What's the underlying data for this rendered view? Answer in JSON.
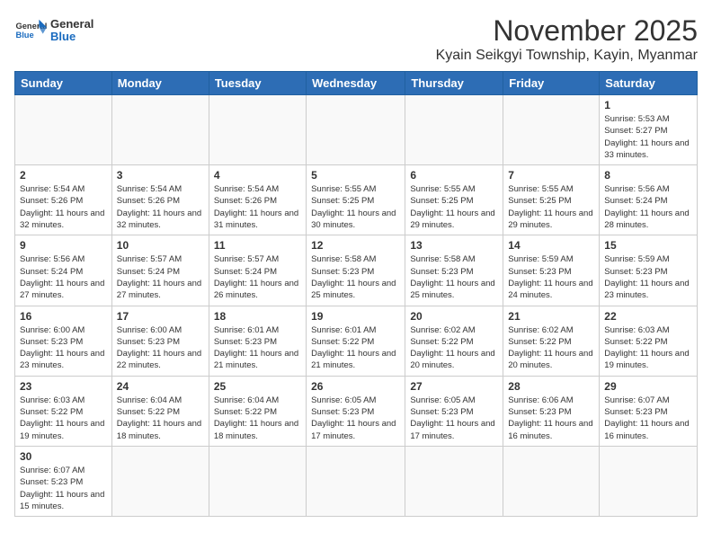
{
  "header": {
    "logo_general": "General",
    "logo_blue": "Blue",
    "month_title": "November 2025",
    "location": "Kyain Seikgyi Township, Kayin, Myanmar"
  },
  "days_of_week": [
    "Sunday",
    "Monday",
    "Tuesday",
    "Wednesday",
    "Thursday",
    "Friday",
    "Saturday"
  ],
  "weeks": [
    [
      {
        "day": null,
        "info": null
      },
      {
        "day": null,
        "info": null
      },
      {
        "day": null,
        "info": null
      },
      {
        "day": null,
        "info": null
      },
      {
        "day": null,
        "info": null
      },
      {
        "day": null,
        "info": null
      },
      {
        "day": "1",
        "info": "Sunrise: 5:53 AM\nSunset: 5:27 PM\nDaylight: 11 hours and 33 minutes."
      }
    ],
    [
      {
        "day": "2",
        "info": "Sunrise: 5:54 AM\nSunset: 5:26 PM\nDaylight: 11 hours and 32 minutes."
      },
      {
        "day": "3",
        "info": "Sunrise: 5:54 AM\nSunset: 5:26 PM\nDaylight: 11 hours and 32 minutes."
      },
      {
        "day": "4",
        "info": "Sunrise: 5:54 AM\nSunset: 5:26 PM\nDaylight: 11 hours and 31 minutes."
      },
      {
        "day": "5",
        "info": "Sunrise: 5:55 AM\nSunset: 5:25 PM\nDaylight: 11 hours and 30 minutes."
      },
      {
        "day": "6",
        "info": "Sunrise: 5:55 AM\nSunset: 5:25 PM\nDaylight: 11 hours and 29 minutes."
      },
      {
        "day": "7",
        "info": "Sunrise: 5:55 AM\nSunset: 5:25 PM\nDaylight: 11 hours and 29 minutes."
      },
      {
        "day": "8",
        "info": "Sunrise: 5:56 AM\nSunset: 5:24 PM\nDaylight: 11 hours and 28 minutes."
      }
    ],
    [
      {
        "day": "9",
        "info": "Sunrise: 5:56 AM\nSunset: 5:24 PM\nDaylight: 11 hours and 27 minutes."
      },
      {
        "day": "10",
        "info": "Sunrise: 5:57 AM\nSunset: 5:24 PM\nDaylight: 11 hours and 27 minutes."
      },
      {
        "day": "11",
        "info": "Sunrise: 5:57 AM\nSunset: 5:24 PM\nDaylight: 11 hours and 26 minutes."
      },
      {
        "day": "12",
        "info": "Sunrise: 5:58 AM\nSunset: 5:23 PM\nDaylight: 11 hours and 25 minutes."
      },
      {
        "day": "13",
        "info": "Sunrise: 5:58 AM\nSunset: 5:23 PM\nDaylight: 11 hours and 25 minutes."
      },
      {
        "day": "14",
        "info": "Sunrise: 5:59 AM\nSunset: 5:23 PM\nDaylight: 11 hours and 24 minutes."
      },
      {
        "day": "15",
        "info": "Sunrise: 5:59 AM\nSunset: 5:23 PM\nDaylight: 11 hours and 23 minutes."
      }
    ],
    [
      {
        "day": "16",
        "info": "Sunrise: 6:00 AM\nSunset: 5:23 PM\nDaylight: 11 hours and 23 minutes."
      },
      {
        "day": "17",
        "info": "Sunrise: 6:00 AM\nSunset: 5:23 PM\nDaylight: 11 hours and 22 minutes."
      },
      {
        "day": "18",
        "info": "Sunrise: 6:01 AM\nSunset: 5:23 PM\nDaylight: 11 hours and 21 minutes."
      },
      {
        "day": "19",
        "info": "Sunrise: 6:01 AM\nSunset: 5:22 PM\nDaylight: 11 hours and 21 minutes."
      },
      {
        "day": "20",
        "info": "Sunrise: 6:02 AM\nSunset: 5:22 PM\nDaylight: 11 hours and 20 minutes."
      },
      {
        "day": "21",
        "info": "Sunrise: 6:02 AM\nSunset: 5:22 PM\nDaylight: 11 hours and 20 minutes."
      },
      {
        "day": "22",
        "info": "Sunrise: 6:03 AM\nSunset: 5:22 PM\nDaylight: 11 hours and 19 minutes."
      }
    ],
    [
      {
        "day": "23",
        "info": "Sunrise: 6:03 AM\nSunset: 5:22 PM\nDaylight: 11 hours and 19 minutes."
      },
      {
        "day": "24",
        "info": "Sunrise: 6:04 AM\nSunset: 5:22 PM\nDaylight: 11 hours and 18 minutes."
      },
      {
        "day": "25",
        "info": "Sunrise: 6:04 AM\nSunset: 5:22 PM\nDaylight: 11 hours and 18 minutes."
      },
      {
        "day": "26",
        "info": "Sunrise: 6:05 AM\nSunset: 5:23 PM\nDaylight: 11 hours and 17 minutes."
      },
      {
        "day": "27",
        "info": "Sunrise: 6:05 AM\nSunset: 5:23 PM\nDaylight: 11 hours and 17 minutes."
      },
      {
        "day": "28",
        "info": "Sunrise: 6:06 AM\nSunset: 5:23 PM\nDaylight: 11 hours and 16 minutes."
      },
      {
        "day": "29",
        "info": "Sunrise: 6:07 AM\nSunset: 5:23 PM\nDaylight: 11 hours and 16 minutes."
      }
    ],
    [
      {
        "day": "30",
        "info": "Sunrise: 6:07 AM\nSunset: 5:23 PM\nDaylight: 11 hours and 15 minutes."
      },
      {
        "day": null,
        "info": null
      },
      {
        "day": null,
        "info": null
      },
      {
        "day": null,
        "info": null
      },
      {
        "day": null,
        "info": null
      },
      {
        "day": null,
        "info": null
      },
      {
        "day": null,
        "info": null
      }
    ]
  ]
}
